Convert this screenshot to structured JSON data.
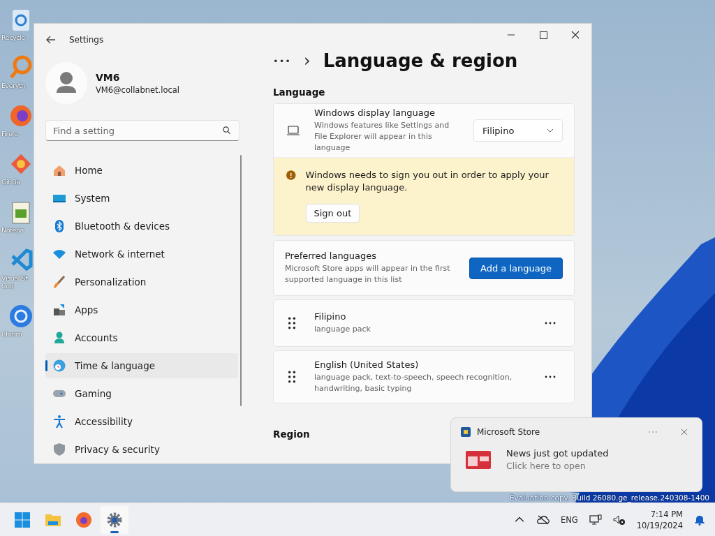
{
  "desktop": {
    "icons": [
      {
        "lines": [
          "Recycle"
        ]
      },
      {
        "lines": [
          "Everyth"
        ]
      },
      {
        "lines": [
          "Firefo"
        ]
      },
      {
        "lines": [
          "Git Ba"
        ]
      },
      {
        "lines": [
          "Notepa"
        ]
      },
      {
        "lines": [
          "Visual St",
          "Cod"
        ]
      },
      {
        "lines": [
          "Chrom"
        ]
      }
    ],
    "watermark": "Evaluation copy. Build 26080.ge_release.240308-1400"
  },
  "window": {
    "title": "Settings"
  },
  "profile": {
    "name": "VM6",
    "email": "VM6@collabnet.local"
  },
  "search": {
    "placeholder": "Find a setting"
  },
  "sidebar": {
    "items": [
      {
        "label": "Home",
        "selected": false
      },
      {
        "label": "System",
        "selected": false
      },
      {
        "label": "Bluetooth & devices",
        "selected": false
      },
      {
        "label": "Network & internet",
        "selected": false
      },
      {
        "label": "Personalization",
        "selected": false
      },
      {
        "label": "Apps",
        "selected": false
      },
      {
        "label": "Accounts",
        "selected": false
      },
      {
        "label": "Time & language",
        "selected": true
      },
      {
        "label": "Gaming",
        "selected": false
      },
      {
        "label": "Accessibility",
        "selected": false
      },
      {
        "label": "Privacy & security",
        "selected": false
      }
    ]
  },
  "breadcrumb": {
    "more": "•••",
    "separator": "›",
    "title": "Language & region"
  },
  "language_section": {
    "heading": "Language",
    "display_language": {
      "title": "Windows display language",
      "description": "Windows features like Settings and File Explorer will appear in this language",
      "value": "Filipino"
    },
    "warning": {
      "text": "Windows needs to sign you out in order to apply your new display language.",
      "button": "Sign out"
    },
    "preferred": {
      "title": "Preferred languages",
      "description": "Microsoft Store apps will appear in the first supported language in this list",
      "button": "Add a language"
    },
    "languages": [
      {
        "name": "Filipino",
        "features": "language pack"
      },
      {
        "name": "English (United States)",
        "features": "language pack, text-to-speech, speech recognition, handwriting, basic typing"
      }
    ]
  },
  "region_section": {
    "heading": "Region"
  },
  "notification": {
    "app": "Microsoft Store",
    "title": "News just got updated",
    "body": "Click here to open"
  },
  "taskbar": {
    "apps": [
      {
        "selected": false
      },
      {
        "selected": false
      },
      {
        "selected": false
      },
      {
        "selected": true
      }
    ],
    "language": "ENG",
    "time": "7:14 PM",
    "date": "10/19/2024"
  }
}
